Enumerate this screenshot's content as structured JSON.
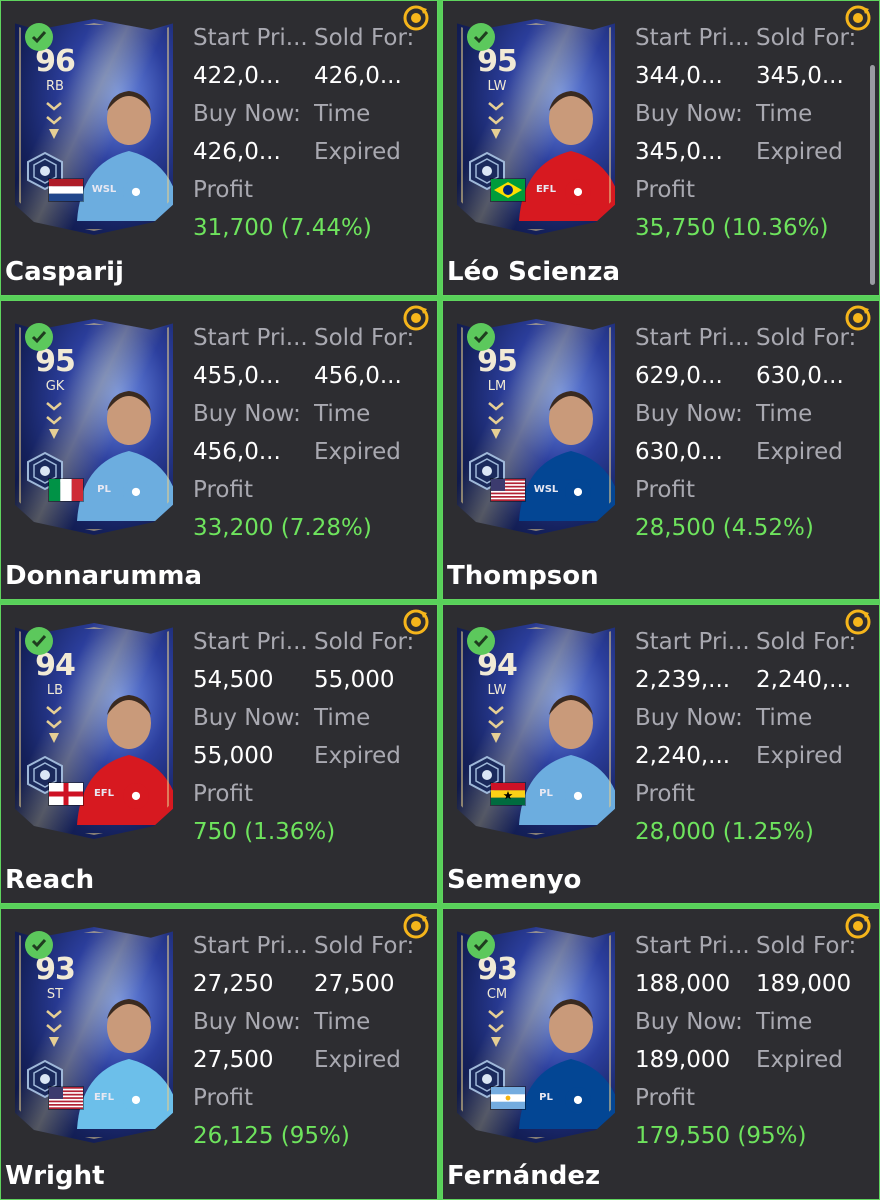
{
  "labels": {
    "start_price": "Start Pri...",
    "sold_for": "Sold For:",
    "buy_now": "Buy Now:",
    "time": "Time",
    "expired": "Expired",
    "profit": "Profit"
  },
  "colors": {
    "tile_bg": "#2d2d31",
    "tile_border": "#5fd45e",
    "profit_green": "#6ee35d",
    "label_gray": "#a9a9b1",
    "check_green": "#5cc85c",
    "relist_orange": "#f5b51b"
  },
  "items": [
    {
      "name": "Casparij",
      "rating": "96",
      "position": "RB",
      "start_price": "422,0...",
      "sold_for": "426,0...",
      "buy_now": "426,0...",
      "profit": "31,700 (7.44%)",
      "league_label": "WSL",
      "playstyle_icon": "shield-icon",
      "nation": "netherlands",
      "club_color": "#6caddf"
    },
    {
      "name": "Léo Scienza",
      "rating": "95",
      "position": "LW",
      "start_price": "344,0...",
      "sold_for": "345,0...",
      "buy_now": "345,0...",
      "profit": "35,750 (10.36%)",
      "league_label": "EFL",
      "playstyle_icon": "dribble-icon",
      "nation": "brazil",
      "club_color": "#d71920"
    },
    {
      "name": "Donnarumma",
      "rating": "95",
      "position": "GK",
      "start_price": "455,0...",
      "sold_for": "456,0...",
      "buy_now": "456,0...",
      "profit": "33,200 (7.28%)",
      "league_label": "PL",
      "playstyle_icon": "footwork-icon",
      "nation": "italy",
      "club_color": "#6caddf"
    },
    {
      "name": "Thompson",
      "rating": "95",
      "position": "LM",
      "start_price": "629,0...",
      "sold_for": "630,0...",
      "buy_now": "630,0...",
      "profit": "28,500 (4.52%)",
      "league_label": "WSL",
      "playstyle_icon": "rocket-icon",
      "nation": "usa",
      "club_color": "#034694"
    },
    {
      "name": "Reach",
      "rating": "94",
      "position": "LB",
      "start_price": "54,500",
      "sold_for": "55,000",
      "buy_now": "55,000",
      "profit": "750 (1.36%)",
      "league_label": "EFL",
      "playstyle_icon": "anchor-icon",
      "nation": "england",
      "club_color": "#d71920"
    },
    {
      "name": "Semenyo",
      "rating": "94",
      "position": "LW",
      "start_price": "2,239,...",
      "sold_for": "2,240,...",
      "buy_now": "2,240,...",
      "profit": "28,000 (1.25%)",
      "league_label": "PL",
      "playstyle_icon": "finesse-icon",
      "nation": "ghana",
      "club_color": "#6caddf"
    },
    {
      "name": "Wright",
      "rating": "93",
      "position": "ST",
      "start_price": "27,250",
      "sold_for": "27,500",
      "buy_now": "27,500",
      "profit": "26,125 (95%)",
      "league_label": "EFL",
      "playstyle_icon": "acrobatic-icon",
      "nation": "usa",
      "club_color": "#6cbfea"
    },
    {
      "name": "Fernández",
      "rating": "93",
      "position": "CM",
      "start_price": "188,000",
      "sold_for": "189,000",
      "buy_now": "189,000",
      "profit": "179,550 (95%)",
      "league_label": "PL",
      "playstyle_icon": "pinged-pass-icon",
      "nation": "argentina",
      "club_color": "#034694"
    }
  ]
}
